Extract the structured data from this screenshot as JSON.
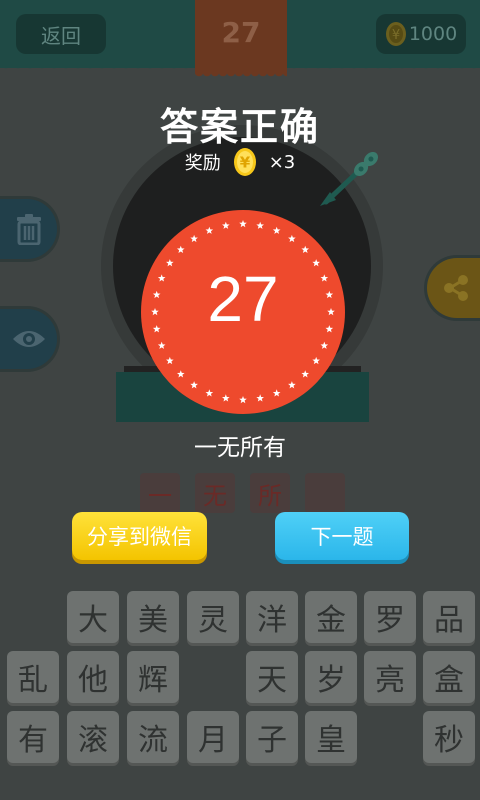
{
  "header": {
    "back_label": "返回",
    "level": "27",
    "coins": "1000"
  },
  "result": {
    "title": "答案正确",
    "reward_label": "奖励",
    "reward_multiplier": "×3",
    "level_badge": "27",
    "answer": "一无所有"
  },
  "answer_slots": [
    "一",
    "无",
    "所",
    ""
  ],
  "actions": {
    "share_label": "分享到微信",
    "next_label": "下一题"
  },
  "letter_grid": [
    [
      "",
      "大",
      "美",
      "灵",
      "洋",
      "金",
      "罗",
      "品"
    ],
    [
      "乱",
      "他",
      "辉",
      "",
      "天",
      "岁",
      "亮",
      "盒"
    ],
    [
      "有",
      "滚",
      "流",
      "月",
      "子",
      "皇",
      "",
      "秒"
    ]
  ],
  "icons": {
    "trash": "trash-icon",
    "eye": "eye-icon",
    "share": "share-icon",
    "coin": "yuan-coin-icon",
    "dart": "dart-icon"
  },
  "colors": {
    "badge_red": "#ee4a2d",
    "share_yellow": "#f7d31b",
    "next_blue": "#36c0f0",
    "header_teal": "#1f4a45"
  }
}
